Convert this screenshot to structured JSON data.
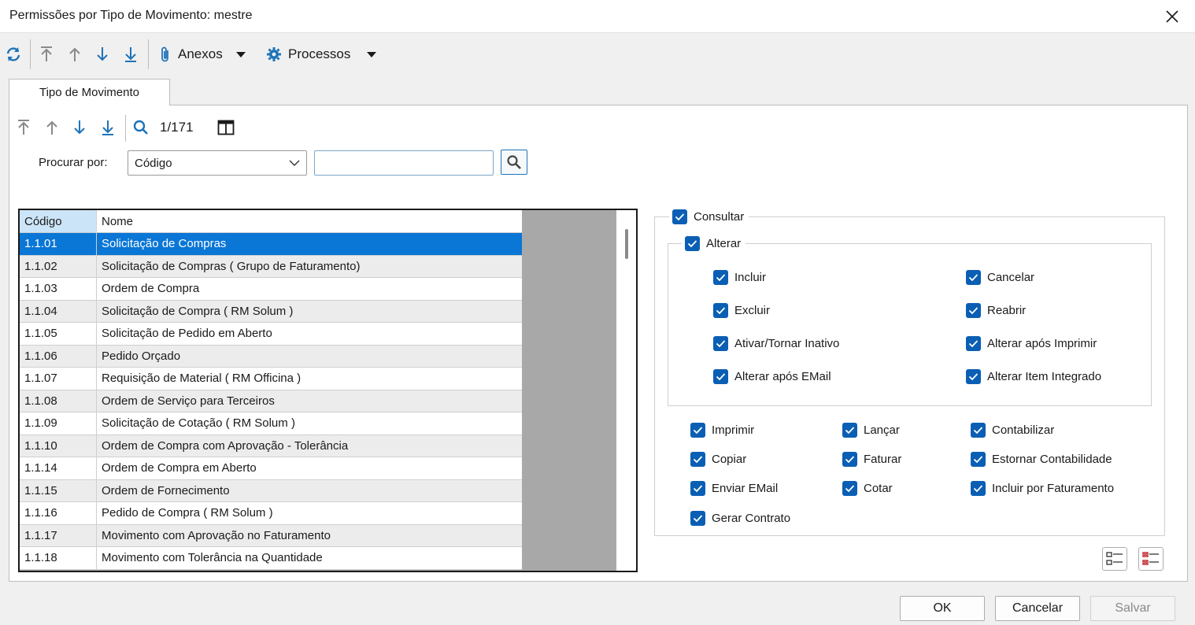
{
  "window": {
    "title": "Permissões por Tipo de Movimento: mestre"
  },
  "toolbar": {
    "anexos_label": "Anexos",
    "processos_label": "Processos"
  },
  "tabs": [
    {
      "label": "Tipo de Movimento"
    }
  ],
  "navigator": {
    "record_position": "1/171"
  },
  "search": {
    "label": "Procurar por:",
    "field_value": "Código",
    "input_value": ""
  },
  "grid": {
    "headers": [
      "Código",
      "Nome"
    ],
    "rows": [
      [
        "1.1.01",
        "Solicitação de Compras"
      ],
      [
        "1.1.02",
        "Solicitação de Compras ( Grupo de Faturamento)"
      ],
      [
        "1.1.03",
        "Ordem de Compra"
      ],
      [
        "1.1.04",
        "Solicitação de Compra  ( RM Solum )"
      ],
      [
        "1.1.05",
        "Solicitação de Pedido em Aberto"
      ],
      [
        "1.1.06",
        "Pedido Orçado"
      ],
      [
        "1.1.07",
        "Requisição de Material ( RM Officina )"
      ],
      [
        "1.1.08",
        "Ordem de Serviço para Terceiros"
      ],
      [
        "1.1.09",
        "Solicitação de Cotação  ( RM Solum )"
      ],
      [
        "1.1.10",
        "Ordem de Compra com Aprovação - Tolerância"
      ],
      [
        "1.1.14",
        "Ordem de Compra em Aberto"
      ],
      [
        "1.1.15",
        "Ordem de Fornecimento"
      ],
      [
        "1.1.16",
        "Pedido de Compra  ( RM Solum )"
      ],
      [
        "1.1.17",
        "Movimento com Aprovação no Faturamento"
      ],
      [
        "1.1.18",
        "Movimento com Tolerância na Quantidade"
      ]
    ],
    "selected_index": 0
  },
  "permissions": {
    "consultar": "Consultar",
    "alterar": "Alterar",
    "alterar_items": [
      "Incluir",
      "Cancelar",
      "Excluir",
      "Reabrir",
      "Ativar/Tornar Inativo",
      "Alterar após Imprimir",
      "Alterar após EMail",
      "Alterar Item Integrado"
    ],
    "other_items": [
      "Imprimir",
      "Lançar",
      "Contabilizar",
      "Copiar",
      "Faturar",
      "Estornar Contabilidade",
      "Enviar EMail",
      "Cotar",
      "Incluir por Faturamento",
      "Gerar Contrato"
    ]
  },
  "buttons": {
    "ok": "OK",
    "cancel": "Cancelar",
    "save": "Salvar"
  },
  "colors": {
    "accent": "#0a5fb4",
    "selection": "#0a76d6",
    "grid_bg": "#a8a8a8"
  }
}
